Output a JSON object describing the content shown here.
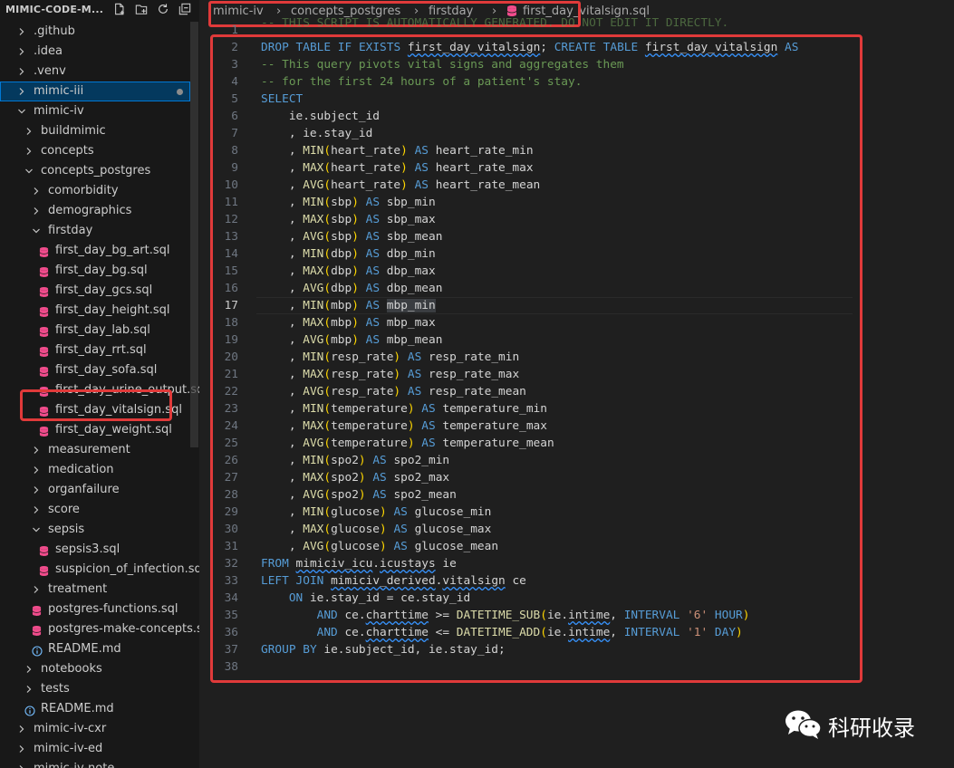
{
  "explorer": {
    "title": "MIMIC-CODE-M...",
    "actions": [
      "new-file-icon",
      "new-folder-icon",
      "refresh-icon",
      "collapse-all-icon"
    ],
    "items": [
      {
        "label": ".github",
        "type": "folder",
        "expanded": false,
        "depth": 0
      },
      {
        "label": ".idea",
        "type": "folder",
        "expanded": false,
        "depth": 0
      },
      {
        "label": ".venv",
        "type": "folder",
        "expanded": false,
        "depth": 0
      },
      {
        "label": "mimic-iii",
        "type": "folder",
        "expanded": false,
        "depth": 0,
        "active": true
      },
      {
        "label": "mimic-iv",
        "type": "folder",
        "expanded": true,
        "depth": 0
      },
      {
        "label": "buildmimic",
        "type": "folder",
        "expanded": false,
        "depth": 1
      },
      {
        "label": "concepts",
        "type": "folder",
        "expanded": false,
        "depth": 1
      },
      {
        "label": "concepts_postgres",
        "type": "folder",
        "expanded": true,
        "depth": 1
      },
      {
        "label": "comorbidity",
        "type": "folder",
        "expanded": false,
        "depth": 2
      },
      {
        "label": "demographics",
        "type": "folder",
        "expanded": false,
        "depth": 2
      },
      {
        "label": "firstday",
        "type": "folder",
        "expanded": true,
        "depth": 2
      },
      {
        "label": "first_day_bg_art.sql",
        "type": "sql",
        "depth": 3
      },
      {
        "label": "first_day_bg.sql",
        "type": "sql",
        "depth": 3
      },
      {
        "label": "first_day_gcs.sql",
        "type": "sql",
        "depth": 3
      },
      {
        "label": "first_day_height.sql",
        "type": "sql",
        "depth": 3
      },
      {
        "label": "first_day_lab.sql",
        "type": "sql",
        "depth": 3
      },
      {
        "label": "first_day_rrt.sql",
        "type": "sql",
        "depth": 3
      },
      {
        "label": "first_day_sofa.sql",
        "type": "sql",
        "depth": 3
      },
      {
        "label": "first_day_urine_output.sql",
        "type": "sql",
        "depth": 3
      },
      {
        "label": "first_day_vitalsign.sql",
        "type": "sql",
        "depth": 3
      },
      {
        "label": "first_day_weight.sql",
        "type": "sql",
        "depth": 3
      },
      {
        "label": "measurement",
        "type": "folder",
        "expanded": false,
        "depth": 2
      },
      {
        "label": "medication",
        "type": "folder",
        "expanded": false,
        "depth": 2
      },
      {
        "label": "organfailure",
        "type": "folder",
        "expanded": false,
        "depth": 2
      },
      {
        "label": "score",
        "type": "folder",
        "expanded": false,
        "depth": 2
      },
      {
        "label": "sepsis",
        "type": "folder",
        "expanded": true,
        "depth": 2
      },
      {
        "label": "sepsis3.sql",
        "type": "sql",
        "depth": 3
      },
      {
        "label": "suspicion_of_infection.sql",
        "type": "sql",
        "depth": 3
      },
      {
        "label": "treatment",
        "type": "folder",
        "expanded": false,
        "depth": 2
      },
      {
        "label": "postgres-functions.sql",
        "type": "sql",
        "depth": 2
      },
      {
        "label": "postgres-make-concepts.sql",
        "type": "sql",
        "depth": 2
      },
      {
        "label": "README.md",
        "type": "info",
        "depth": 2
      },
      {
        "label": "notebooks",
        "type": "folder",
        "expanded": false,
        "depth": 1
      },
      {
        "label": "tests",
        "type": "folder",
        "expanded": false,
        "depth": 1
      },
      {
        "label": "README.md",
        "type": "info",
        "depth": 1
      },
      {
        "label": "mimic-iv-cxr",
        "type": "folder",
        "expanded": false,
        "depth": 0
      },
      {
        "label": "mimic-iv-ed",
        "type": "folder",
        "expanded": false,
        "depth": 0
      },
      {
        "label": "mimic-iv-note",
        "type": "folder",
        "expanded": false,
        "depth": 0
      }
    ]
  },
  "breadcrumb": [
    "mimic-iv",
    "concepts_postgres",
    "firstday",
    "first_day_vitalsign.sql"
  ],
  "editor": {
    "faded_line1": "-- THIS SCRIPT IS AUTOMATICALLY GENERATED. DO NOT EDIT IT DIRECTLY.",
    "current_line": 17,
    "lines": [
      {
        "n": "1",
        "t": ""
      },
      {
        "n": "2",
        "t": "DROP TABLE IF EXISTS first_day_vitalsign; CREATE TABLE first_day_vitalsign AS"
      },
      {
        "n": "3",
        "t": "-- This query pivots vital signs and aggregates them"
      },
      {
        "n": "4",
        "t": "-- for the first 24 hours of a patient's stay."
      },
      {
        "n": "5",
        "t": "SELECT"
      },
      {
        "n": "6",
        "t": "    ie.subject_id"
      },
      {
        "n": "7",
        "t": "    , ie.stay_id"
      },
      {
        "n": "8",
        "t": "    , MIN(heart_rate) AS heart_rate_min"
      },
      {
        "n": "9",
        "t": "    , MAX(heart_rate) AS heart_rate_max"
      },
      {
        "n": "10",
        "t": "    , AVG(heart_rate) AS heart_rate_mean"
      },
      {
        "n": "11",
        "t": "    , MIN(sbp) AS sbp_min"
      },
      {
        "n": "12",
        "t": "    , MAX(sbp) AS sbp_max"
      },
      {
        "n": "13",
        "t": "    , AVG(sbp) AS sbp_mean"
      },
      {
        "n": "14",
        "t": "    , MIN(dbp) AS dbp_min"
      },
      {
        "n": "15",
        "t": "    , MAX(dbp) AS dbp_max"
      },
      {
        "n": "16",
        "t": "    , AVG(dbp) AS dbp_mean"
      },
      {
        "n": "17",
        "t": "    , MIN(mbp) AS mbp_min"
      },
      {
        "n": "18",
        "t": "    , MAX(mbp) AS mbp_max"
      },
      {
        "n": "19",
        "t": "    , AVG(mbp) AS mbp_mean"
      },
      {
        "n": "20",
        "t": "    , MIN(resp_rate) AS resp_rate_min"
      },
      {
        "n": "21",
        "t": "    , MAX(resp_rate) AS resp_rate_max"
      },
      {
        "n": "22",
        "t": "    , AVG(resp_rate) AS resp_rate_mean"
      },
      {
        "n": "23",
        "t": "    , MIN(temperature) AS temperature_min"
      },
      {
        "n": "24",
        "t": "    , MAX(temperature) AS temperature_max"
      },
      {
        "n": "25",
        "t": "    , AVG(temperature) AS temperature_mean"
      },
      {
        "n": "26",
        "t": "    , MIN(spo2) AS spo2_min"
      },
      {
        "n": "27",
        "t": "    , MAX(spo2) AS spo2_max"
      },
      {
        "n": "28",
        "t": "    , AVG(spo2) AS spo2_mean"
      },
      {
        "n": "29",
        "t": "    , MIN(glucose) AS glucose_min"
      },
      {
        "n": "30",
        "t": "    , MAX(glucose) AS glucose_max"
      },
      {
        "n": "31",
        "t": "    , AVG(glucose) AS glucose_mean"
      },
      {
        "n": "32",
        "t": "FROM mimiciv_icu.icustays ie"
      },
      {
        "n": "33",
        "t": "LEFT JOIN mimiciv_derived.vitalsign ce"
      },
      {
        "n": "34",
        "t": "    ON ie.stay_id = ce.stay_id"
      },
      {
        "n": "35",
        "t": "        AND ce.charttime >= DATETIME_SUB(ie.intime, INTERVAL '6' HOUR)"
      },
      {
        "n": "36",
        "t": "        AND ce.charttime <= DATETIME_ADD(ie.intime, INTERVAL '1' DAY)"
      },
      {
        "n": "37",
        "t": "GROUP BY ie.subject_id, ie.stay_id;"
      },
      {
        "n": "38",
        "t": ""
      }
    ]
  },
  "watermark": {
    "text": "科研收录",
    "icon": "wechat-icon"
  },
  "colors": {
    "highlight_box": "#e03a3a",
    "active_row": "#04395e",
    "keyword": "#569cd6",
    "function": "#dcdcaa",
    "comment": "#6a9955",
    "string": "#ce9178"
  }
}
